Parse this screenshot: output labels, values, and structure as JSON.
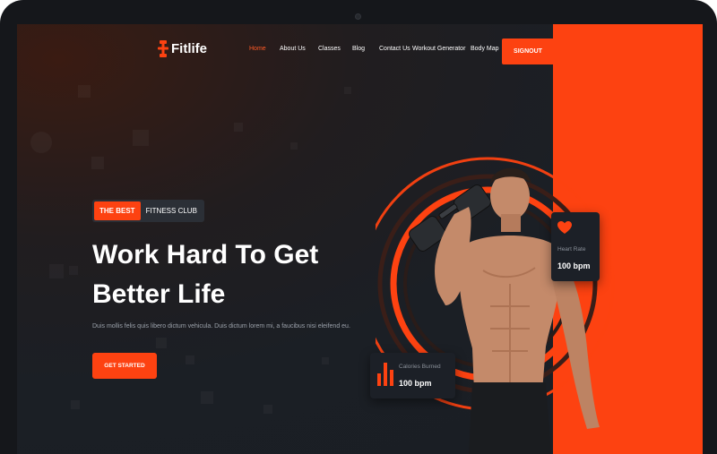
{
  "brand": {
    "name": "Fitlife"
  },
  "nav": {
    "items": [
      "Home",
      "About Us",
      "Classes",
      "Blog",
      "Contact Us",
      "Workout Generator",
      "Body Map"
    ],
    "active": "Home",
    "signout_label": "SIGNOUT"
  },
  "hero": {
    "badge_highlight": "THE BEST",
    "badge_text": "FITNESS CLUB",
    "title_line1": "Work Hard To Get",
    "title_line2": "Better Life",
    "subtitle": "Duis mollis felis quis libero dictum vehicula. Duis dictum lorem mi, a faucibus nisi eleifend eu.",
    "cta_label": "GET STARTED"
  },
  "stats": {
    "heart_rate": {
      "label": "Heart Rate",
      "value": "100 bpm",
      "icon": "heart-icon"
    },
    "calories": {
      "label": "Calories Burned",
      "value": "100 bpm",
      "icon": "bar-chart-icon"
    }
  },
  "colors": {
    "accent": "#fd4211",
    "background": "#1a1e24",
    "card": "#1c2027",
    "text": "#ffffff",
    "muted": "#9ba1aa"
  }
}
